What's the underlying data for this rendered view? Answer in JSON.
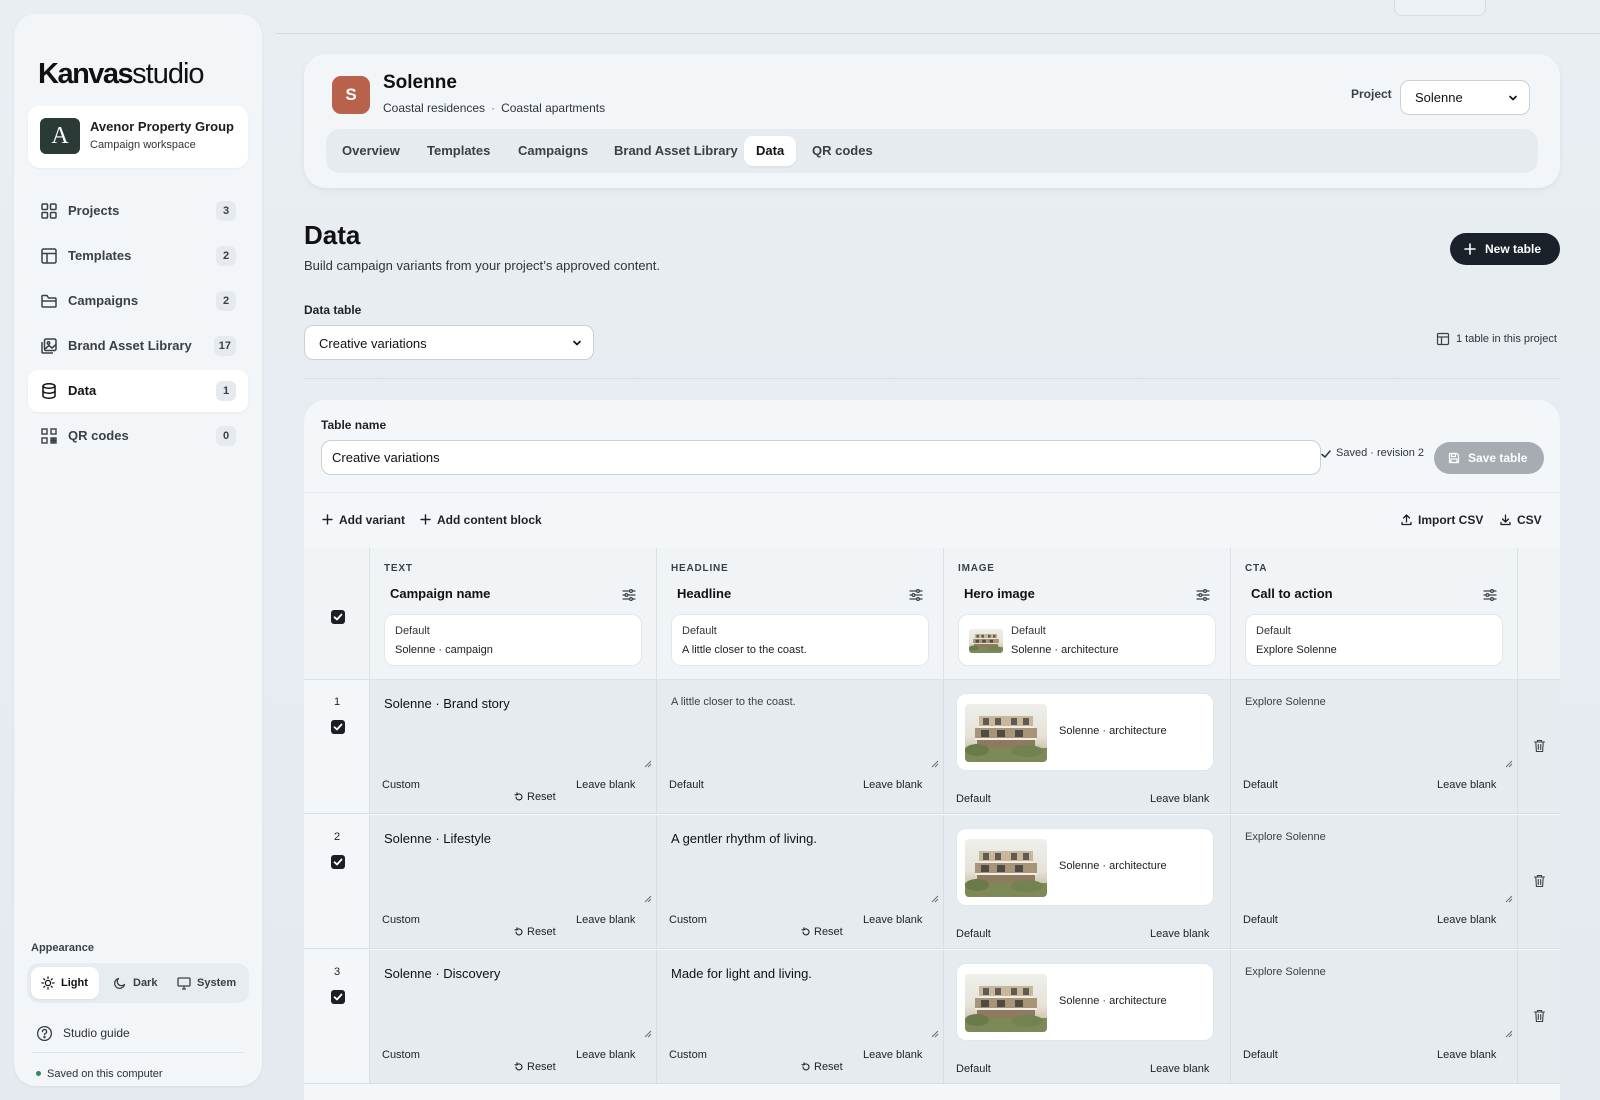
{
  "sidebar": {
    "logo_bold": "Kanvas",
    "logo_light": "studio",
    "workspace": {
      "initial": "A",
      "name": "Avenor Property Group",
      "subtitle": "Campaign workspace"
    },
    "nav": [
      {
        "label": "Projects",
        "count": "3",
        "icon": "grid-icon"
      },
      {
        "label": "Templates",
        "count": "2",
        "icon": "layout-icon"
      },
      {
        "label": "Campaigns",
        "count": "2",
        "icon": "folder-icon"
      },
      {
        "label": "Brand Asset Library",
        "count": "17",
        "icon": "images-icon"
      },
      {
        "label": "Data",
        "count": "1",
        "icon": "database-icon",
        "active": true
      },
      {
        "label": "QR codes",
        "count": "0",
        "icon": "qr-icon"
      }
    ],
    "appearance_title": "Appearance",
    "appearance": [
      "Light",
      "Dark",
      "System"
    ],
    "guide": "Studio guide",
    "saved_local": "Saved on this computer"
  },
  "project": {
    "initial": "S",
    "name": "Solenne",
    "category": "Coastal residences",
    "type": "Coastal apartments",
    "select_label": "Project",
    "select_value": "Solenne",
    "tabs": [
      "Overview",
      "Templates",
      "Campaigns",
      "Brand Asset Library",
      "Data",
      "QR codes"
    ],
    "active_tab": "Data"
  },
  "page": {
    "title": "Data",
    "subtitle": "Build campaign variants from your project’s approved content.",
    "new_table": "New table",
    "data_table_label": "Data table",
    "data_table_value": "Creative variations",
    "tables_count": "1 table in this project"
  },
  "editor": {
    "table_name_label": "Table name",
    "table_name_value": "Creative variations",
    "saved_status": "Saved · revision 2",
    "save_button": "Save table",
    "add_variant": "Add variant",
    "add_content_block": "Add content block",
    "import_csv": "Import CSV",
    "export_csv": "CSV",
    "columns": [
      {
        "type": "TEXT",
        "name": "Campaign name",
        "default_label": "Default",
        "default_value": "Solenne · campaign"
      },
      {
        "type": "HEADLINE",
        "name": "Headline",
        "default_label": "Default",
        "default_value": "A little closer to the coast."
      },
      {
        "type": "IMAGE",
        "name": "Hero image",
        "default_label": "Default",
        "default_value": "Solenne · architecture"
      },
      {
        "type": "CTA",
        "name": "Call to action",
        "default_label": "Default",
        "default_value": "Explore Solenne"
      }
    ],
    "rows": [
      {
        "num": "1",
        "text": "Solenne · Brand story",
        "text_state": "Custom",
        "headline": "A little closer to the coast.",
        "headline_state": "Default",
        "image": "Solenne · architecture",
        "image_state": "Default",
        "cta": "Explore Solenne",
        "cta_state": "Default"
      },
      {
        "num": "2",
        "text": "Solenne · Lifestyle",
        "text_state": "Custom",
        "headline": "A gentler rhythm of living.",
        "headline_state": "Custom",
        "image": "Solenne · architecture",
        "image_state": "Default",
        "cta": "Explore Solenne",
        "cta_state": "Default"
      },
      {
        "num": "3",
        "text": "Solenne · Discovery",
        "text_state": "Custom",
        "headline": "Made for light and living.",
        "headline_state": "Custom",
        "image": "Solenne · architecture",
        "image_state": "Default",
        "cta": "Explore Solenne",
        "cta_state": "Default"
      }
    ],
    "reset_label": "Reset",
    "leave_blank_label": "Leave blank"
  }
}
